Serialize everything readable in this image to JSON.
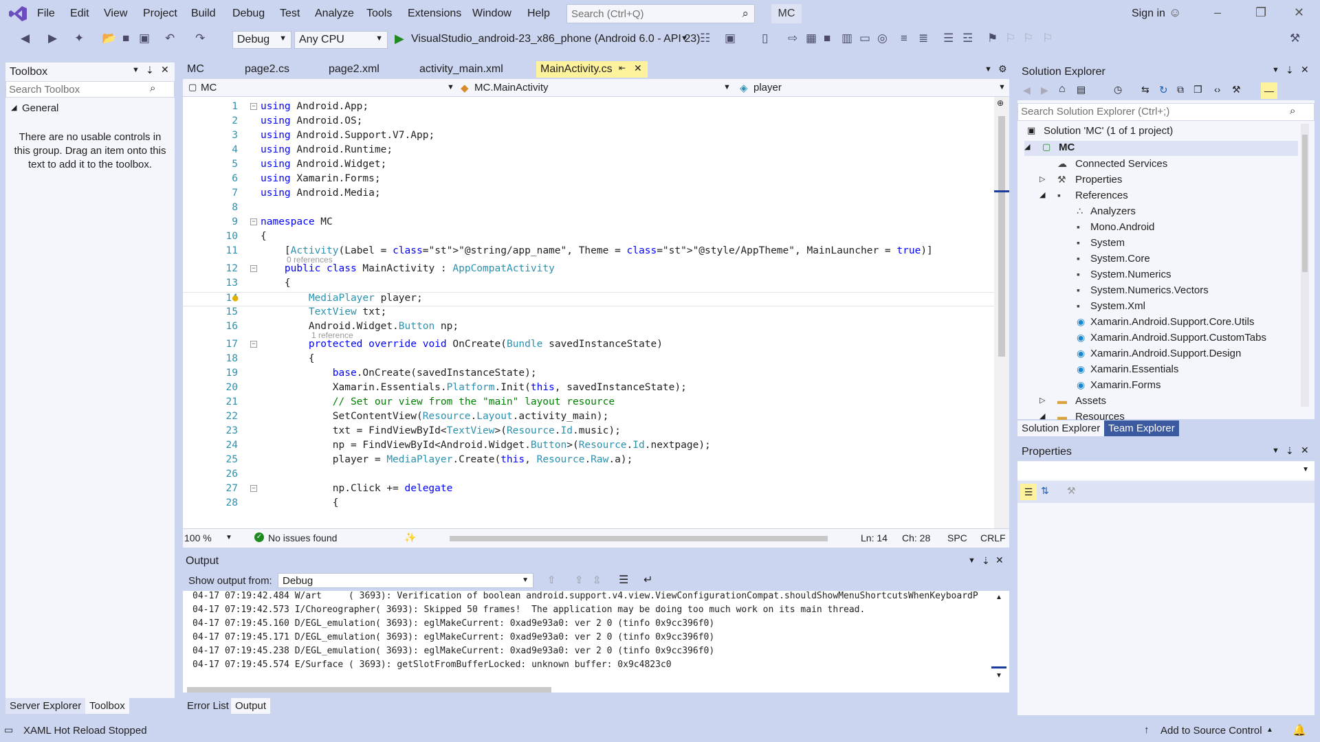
{
  "app": {
    "title": "MC",
    "signin": "Sign in"
  },
  "menu": [
    "File",
    "Edit",
    "View",
    "Project",
    "Build",
    "Debug",
    "Test",
    "Analyze",
    "Tools",
    "Extensions",
    "Window",
    "Help"
  ],
  "search": {
    "placeholder": "Search (Ctrl+Q)"
  },
  "toolbar": {
    "config": "Debug",
    "platform": "Any CPU",
    "run_target": "VisualStudio_android-23_x86_phone (Android 6.0 - API 23)"
  },
  "toolbox": {
    "title": "Toolbox",
    "search_placeholder": "Search Toolbox",
    "group": "General",
    "empty_message": "There are no usable controls in this group. Drag an item onto this text to add it to the toolbox."
  },
  "editor": {
    "tabs": [
      "MC",
      "page2.cs",
      "page2.xml",
      "activity_main.xml",
      "MainActivity.cs"
    ],
    "nav": {
      "project": "MC",
      "class": "MC.MainActivity",
      "member": "player"
    },
    "lines": [
      {
        "n": "1",
        "code": "using Android.App;"
      },
      {
        "n": "2",
        "code": "using Android.OS;"
      },
      {
        "n": "3",
        "code": "using Android.Support.V7.App;"
      },
      {
        "n": "4",
        "code": "using Android.Runtime;"
      },
      {
        "n": "5",
        "code": "using Android.Widget;"
      },
      {
        "n": "6",
        "code": "using Xamarin.Forms;"
      },
      {
        "n": "7",
        "code": "using Android.Media;"
      },
      {
        "n": "8",
        "code": ""
      },
      {
        "n": "9",
        "code": "namespace MC"
      },
      {
        "n": "10",
        "code": "{"
      },
      {
        "n": "11",
        "code": "    [Activity(Label = \"@string/app_name\", Theme = \"@style/AppTheme\", MainLauncher = true)]"
      },
      {
        "n": "12",
        "code": "    public class MainActivity : AppCompatActivity"
      },
      {
        "n": "13",
        "code": "    {"
      },
      {
        "n": "14",
        "code": "        MediaPlayer player;"
      },
      {
        "n": "15",
        "code": "        TextView txt;"
      },
      {
        "n": "16",
        "code": "        Android.Widget.Button np;"
      },
      {
        "n": "17",
        "code": "        protected override void OnCreate(Bundle savedInstanceState)"
      },
      {
        "n": "18",
        "code": "        {"
      },
      {
        "n": "19",
        "code": "            base.OnCreate(savedInstanceState);"
      },
      {
        "n": "20",
        "code": "            Xamarin.Essentials.Platform.Init(this, savedInstanceState);"
      },
      {
        "n": "21",
        "code": "            // Set our view from the \"main\" layout resource"
      },
      {
        "n": "22",
        "code": "            SetContentView(Resource.Layout.activity_main);"
      },
      {
        "n": "23",
        "code": "            txt = FindViewById<TextView>(Resource.Id.music);"
      },
      {
        "n": "24",
        "code": "            np = FindViewById<Android.Widget.Button>(Resource.Id.nextpage);"
      },
      {
        "n": "25",
        "code": "            player = MediaPlayer.Create(this, Resource.Raw.a);"
      },
      {
        "n": "26",
        "code": ""
      },
      {
        "n": "27",
        "code": "            np.Click += delegate"
      },
      {
        "n": "28",
        "code": "            {"
      }
    ],
    "ref_hints": [
      "0 references",
      "1 reference"
    ],
    "status": {
      "zoom": "100 %",
      "issues": "No issues found",
      "line": "Ln: 14",
      "col": "Ch: 28",
      "spc": "SPC",
      "eol": "CRLF"
    }
  },
  "output": {
    "title": "Output",
    "show_from_label": "Show output from:",
    "source": "Debug",
    "lines": [
      "04-17 07:19:42.484 W/art     ( 3693): Verification of boolean android.support.v4.view.ViewConfigurationCompat.shouldShowMenuShortcutsWhenKeyboardP",
      "04-17 07:19:42.573 I/Choreographer( 3693): Skipped 50 frames!  The application may be doing too much work on its main thread.",
      "04-17 07:19:45.160 D/EGL_emulation( 3693): eglMakeCurrent: 0xad9e93a0: ver 2 0 (tinfo 0x9cc396f0)",
      "04-17 07:19:45.171 D/EGL_emulation( 3693): eglMakeCurrent: 0xad9e93a0: ver 2 0 (tinfo 0x9cc396f0)",
      "04-17 07:19:45.238 D/EGL_emulation( 3693): eglMakeCurrent: 0xad9e93a0: ver 2 0 (tinfo 0x9cc396f0)",
      "04-17 07:19:45.574 E/Surface ( 3693): getSlotFromBufferLocked: unknown buffer: 0x9c4823c0"
    ]
  },
  "solution_explorer": {
    "title": "Solution Explorer",
    "search_placeholder": "Search Solution Explorer (Ctrl+;)",
    "solution": "Solution 'MC' (1 of 1 project)",
    "project": "MC",
    "items": [
      {
        "label": "Connected Services",
        "indent": 1,
        "icon": "connected-services-icon"
      },
      {
        "label": "Properties",
        "indent": 1,
        "icon": "wrench-icon",
        "expander": "collapsed"
      },
      {
        "label": "References",
        "indent": 1,
        "icon": "references-icon",
        "expander": "expanded"
      },
      {
        "label": "Analyzers",
        "indent": 2,
        "icon": "analyzer-icon"
      },
      {
        "label": "Mono.Android",
        "indent": 2,
        "icon": "reference-icon"
      },
      {
        "label": "System",
        "indent": 2,
        "icon": "reference-icon"
      },
      {
        "label": "System.Core",
        "indent": 2,
        "icon": "reference-icon"
      },
      {
        "label": "System.Numerics",
        "indent": 2,
        "icon": "reference-icon"
      },
      {
        "label": "System.Numerics.Vectors",
        "indent": 2,
        "icon": "reference-icon"
      },
      {
        "label": "System.Xml",
        "indent": 2,
        "icon": "reference-icon"
      },
      {
        "label": "Xamarin.Android.Support.Core.Utils",
        "indent": 2,
        "icon": "nuget-icon"
      },
      {
        "label": "Xamarin.Android.Support.CustomTabs",
        "indent": 2,
        "icon": "nuget-icon"
      },
      {
        "label": "Xamarin.Android.Support.Design",
        "indent": 2,
        "icon": "nuget-icon"
      },
      {
        "label": "Xamarin.Essentials",
        "indent": 2,
        "icon": "nuget-icon"
      },
      {
        "label": "Xamarin.Forms",
        "indent": 2,
        "icon": "nuget-icon"
      },
      {
        "label": "Assets",
        "indent": 1,
        "icon": "folder-icon",
        "expander": "collapsed"
      },
      {
        "label": "Resources",
        "indent": 1,
        "icon": "folder-icon",
        "expander": "expanded"
      }
    ],
    "tabs": [
      "Solution Explorer",
      "Team Explorer"
    ]
  },
  "properties": {
    "title": "Properties"
  },
  "bottom_tabs": {
    "left": [
      "Server Explorer",
      "Toolbox"
    ],
    "output": [
      "Error List",
      "Output"
    ]
  },
  "statusbar": {
    "left": "XAML Hot Reload Stopped",
    "right": "Add to Source Control"
  },
  "colors": {
    "accent": "#007acc",
    "chrome": "#ccd5f0",
    "active_tab": "#fff29d",
    "selected_se_tab": "#3c5a9f"
  }
}
